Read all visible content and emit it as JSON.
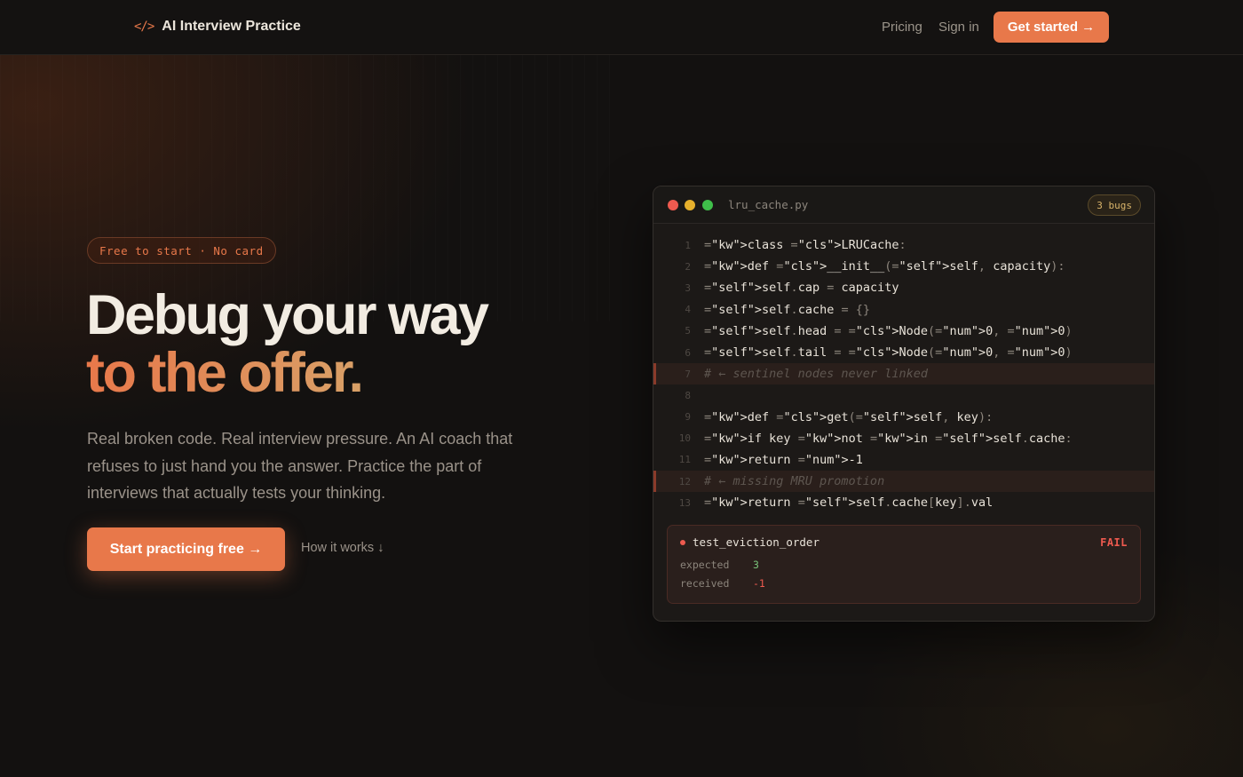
{
  "nav": {
    "brand_icon": "</>",
    "brand_name": "AI Interview Practice",
    "links": [
      "Pricing",
      "Sign in"
    ],
    "cta": "Get started →"
  },
  "hero": {
    "badge": "Free to start · No card",
    "title_line1": "Debug your way",
    "title_line2": "to the offer.",
    "subtitle": "Real broken code. Real interview pressure. An AI coach that refuses to just hand you the answer. Practice the part of interviews that actually tests your thinking.",
    "primary_cta": "Start practicing free →",
    "secondary_cta": "How it works ↓"
  },
  "editor": {
    "filename": "lru_cache.py",
    "bug_count": "3 bugs",
    "lines": [
      {
        "n": "1",
        "code": "class LRUCache:",
        "highlight": false
      },
      {
        "n": "2",
        "code": "def __init__(self, capacity):",
        "highlight": false
      },
      {
        "n": "3",
        "code": "self.cap = capacity",
        "highlight": false
      },
      {
        "n": "4",
        "code": "self.cache = {}",
        "highlight": false
      },
      {
        "n": "5",
        "code": "self.head = Node(0, 0)",
        "highlight": false
      },
      {
        "n": "6",
        "code": "self.tail = Node(0, 0)",
        "highlight": false
      },
      {
        "n": "7",
        "code": "# ← sentinel nodes never linked",
        "highlight": true
      },
      {
        "n": "8",
        "code": "",
        "highlight": false
      },
      {
        "n": "9",
        "code": "def get(self, key):",
        "highlight": false
      },
      {
        "n": "10",
        "code": "if key not in self.cache:",
        "highlight": false
      },
      {
        "n": "11",
        "code": "return -1",
        "highlight": false
      },
      {
        "n": "12",
        "code": "# ← missing MRU promotion",
        "highlight": true
      },
      {
        "n": "13",
        "code": "return self.cache[key].val",
        "highlight": false
      }
    ],
    "test": {
      "name": "test_eviction_order",
      "status": "FAIL",
      "expected_label": "expected",
      "expected_value": "3",
      "received_label": "received",
      "received_value": "-1"
    }
  },
  "colors": {
    "accent": "#e8784a",
    "background": "#131110",
    "fail": "#ee5a4f",
    "pass_value": "#7ac27a"
  }
}
